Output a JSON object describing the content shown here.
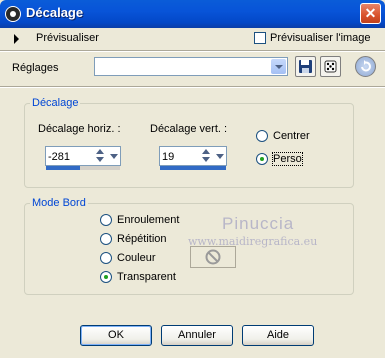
{
  "window": {
    "title": "Décalage",
    "close_glyph": "✕"
  },
  "preview": {
    "label": "Prévisualiser",
    "checkbox_label": "Prévisualiser l'image",
    "checkbox_checked": false
  },
  "settings": {
    "label": "Réglages",
    "value": "",
    "icons": [
      "save-disk-icon",
      "dice-icon",
      "reset-icon"
    ]
  },
  "offset": {
    "title": "Décalage",
    "horiz_label": "Décalage horiz. :",
    "horiz_value": "-281",
    "vert_label": "Décalage vert. :",
    "vert_value": "19",
    "options": [
      {
        "label": "Centrer",
        "checked": false
      },
      {
        "label": "Perso",
        "checked": true
      }
    ]
  },
  "edge": {
    "title": "Mode Bord",
    "options": [
      {
        "label": "Enroulement",
        "checked": false
      },
      {
        "label": "Répétition",
        "checked": false
      },
      {
        "label": "Couleur",
        "checked": false
      },
      {
        "label": "Transparent",
        "checked": true
      }
    ]
  },
  "watermark": {
    "name": "Pinuccia",
    "site": "www.maidiregrafica.eu"
  },
  "buttons": {
    "ok": "OK",
    "cancel": "Annuler",
    "help": "Aide"
  },
  "colors": {
    "title_bar": "#0854d8",
    "group_title": "#0046d5",
    "window_bg": "#ece9d8",
    "radio_dot": "#21a121"
  }
}
